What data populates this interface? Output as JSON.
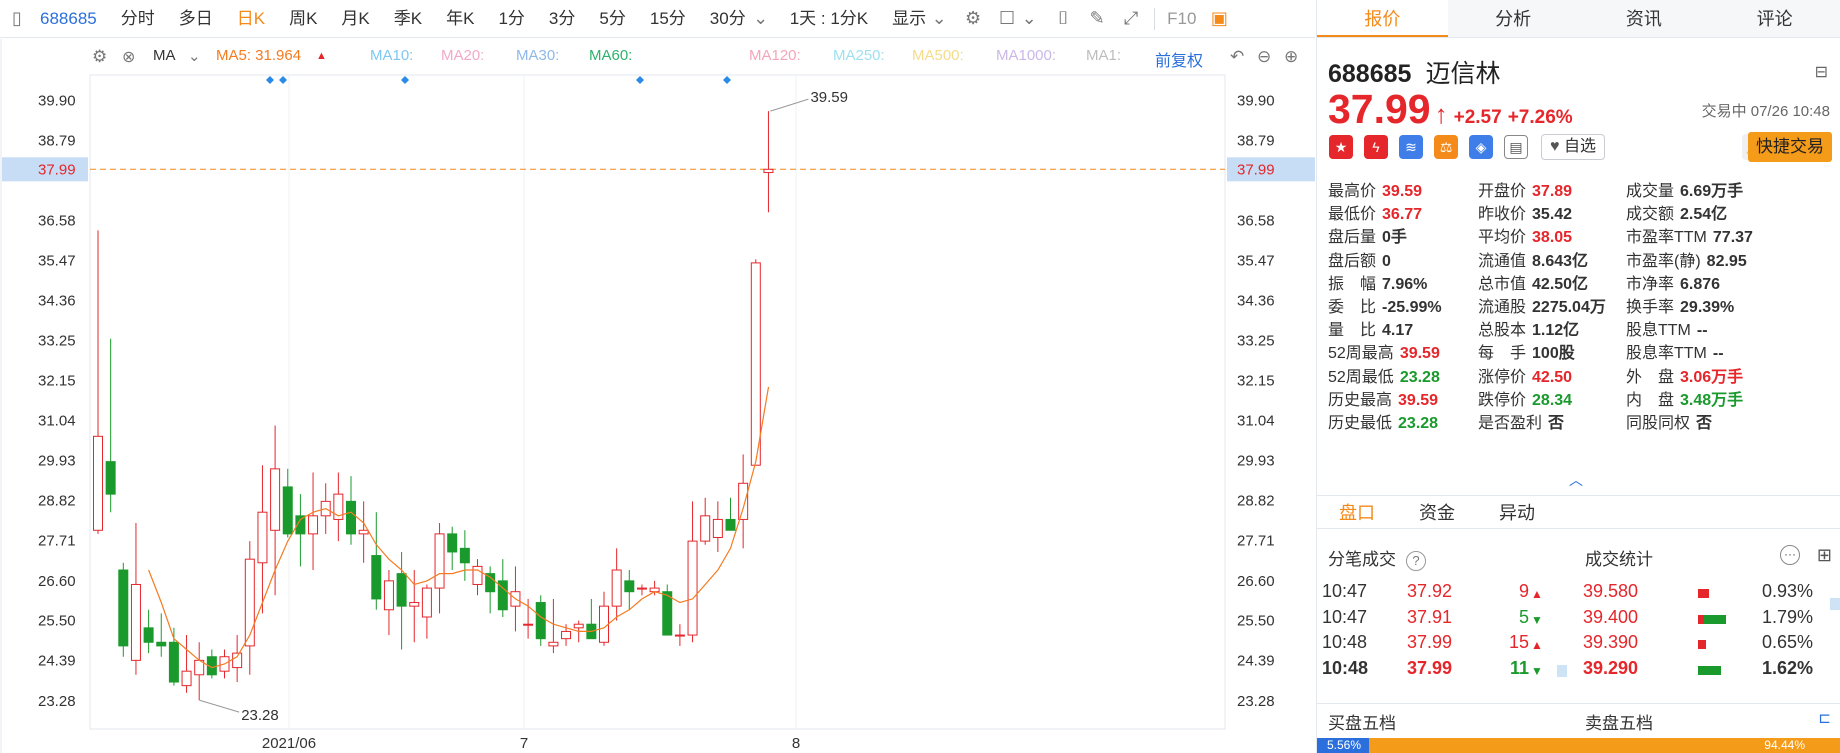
{
  "toolbar": {
    "code": "688685",
    "periods": [
      "分时",
      "多日",
      "日K",
      "周K",
      "月K",
      "季K",
      "年K",
      "1分",
      "3分",
      "5分",
      "15分",
      "30分"
    ],
    "active_period": "日K",
    "range_label": "1天 : 1分K",
    "display_label": "显示",
    "f10_label": "F10"
  },
  "ma_bar": {
    "ma_label": "MA",
    "ma5": "MA5: 31.964",
    "ma10": "MA10:",
    "ma20": "MA20:",
    "ma30": "MA30:",
    "ma60": "MA60:",
    "ma120": "MA120:",
    "ma250": "MA250:",
    "ma500": "MA500:",
    "ma1000": "MA1000:",
    "ma1": "MA1:",
    "fuquan": "前复权",
    "colors": {
      "ma5": "#f47b20",
      "ma10": "#7ec8f2",
      "ma20": "#f4a8c8",
      "ma30": "#8fb8e8",
      "ma60": "#2db36b",
      "ma120": "#f3a6b9",
      "ma250": "#9fe0f0",
      "ma500": "#f5dc8b",
      "ma1000": "#cbb8e8",
      "ma1": "#bdbdbd"
    }
  },
  "chart_data": {
    "type": "candlestick",
    "y_ticks": [
      "39.90",
      "38.79",
      "37.99",
      "36.58",
      "35.47",
      "34.36",
      "33.25",
      "32.15",
      "31.04",
      "29.93",
      "28.82",
      "27.71",
      "26.60",
      "25.50",
      "24.39",
      "23.28"
    ],
    "ylim": [
      22.5,
      40.6
    ],
    "x_ticks": [
      "2021/06",
      "7",
      "8"
    ],
    "current_price": 37.99,
    "high_label": "39.59",
    "low_label": "23.28",
    "up_color": "#e5262b",
    "down_color": "#1a9a2c",
    "ma5_color": "#f47b20",
    "candles": [
      {
        "o": 28.0,
        "h": 36.3,
        "l": 27.9,
        "c": 30.6
      },
      {
        "o": 29.9,
        "h": 33.3,
        "l": 28.5,
        "c": 29.0
      },
      {
        "o": 26.9,
        "h": 27.1,
        "l": 24.5,
        "c": 24.8
      },
      {
        "o": 24.4,
        "h": 28.2,
        "l": 24.0,
        "c": 26.5
      },
      {
        "o": 25.3,
        "h": 25.8,
        "l": 24.6,
        "c": 24.9
      },
      {
        "o": 24.9,
        "h": 25.7,
        "l": 24.5,
        "c": 24.8
      },
      {
        "o": 24.9,
        "h": 25.3,
        "l": 23.7,
        "c": 23.8
      },
      {
        "o": 23.7,
        "h": 25.1,
        "l": 23.5,
        "c": 24.1
      },
      {
        "o": 24.0,
        "h": 24.9,
        "l": 23.3,
        "c": 24.4
      },
      {
        "o": 24.5,
        "h": 24.7,
        "l": 23.9,
        "c": 24.0
      },
      {
        "o": 24.1,
        "h": 24.7,
        "l": 23.9,
        "c": 24.5
      },
      {
        "o": 24.2,
        "h": 25.1,
        "l": 23.8,
        "c": 24.6
      },
      {
        "o": 24.8,
        "h": 27.7,
        "l": 24.0,
        "c": 27.2
      },
      {
        "o": 27.1,
        "h": 29.8,
        "l": 25.7,
        "c": 28.5
      },
      {
        "o": 28.0,
        "h": 30.9,
        "l": 26.2,
        "c": 29.7
      },
      {
        "o": 29.2,
        "h": 29.7,
        "l": 27.8,
        "c": 27.9
      },
      {
        "o": 28.4,
        "h": 29.0,
        "l": 27.0,
        "c": 27.9
      },
      {
        "o": 27.9,
        "h": 29.6,
        "l": 26.9,
        "c": 28.4
      },
      {
        "o": 28.4,
        "h": 29.3,
        "l": 27.9,
        "c": 28.8
      },
      {
        "o": 28.3,
        "h": 29.6,
        "l": 27.7,
        "c": 29.0
      },
      {
        "o": 28.8,
        "h": 29.5,
        "l": 27.6,
        "c": 27.9
      },
      {
        "o": 27.9,
        "h": 28.8,
        "l": 27.1,
        "c": 28.0
      },
      {
        "o": 27.3,
        "h": 28.5,
        "l": 25.8,
        "c": 26.1
      },
      {
        "o": 25.8,
        "h": 26.9,
        "l": 25.1,
        "c": 26.6
      },
      {
        "o": 26.8,
        "h": 27.4,
        "l": 24.7,
        "c": 25.9
      },
      {
        "o": 25.9,
        "h": 26.9,
        "l": 24.9,
        "c": 26.0
      },
      {
        "o": 25.6,
        "h": 26.5,
        "l": 25.0,
        "c": 26.4
      },
      {
        "o": 26.4,
        "h": 28.2,
        "l": 25.7,
        "c": 27.9
      },
      {
        "o": 27.9,
        "h": 28.1,
        "l": 26.9,
        "c": 27.4
      },
      {
        "o": 27.5,
        "h": 28.0,
        "l": 26.6,
        "c": 27.1
      },
      {
        "o": 26.5,
        "h": 27.2,
        "l": 26.2,
        "c": 27.0
      },
      {
        "o": 26.8,
        "h": 27.0,
        "l": 25.7,
        "c": 26.3
      },
      {
        "o": 26.6,
        "h": 27.2,
        "l": 25.6,
        "c": 25.8
      },
      {
        "o": 25.9,
        "h": 27.0,
        "l": 25.2,
        "c": 26.3
      },
      {
        "o": 25.4,
        "h": 26.1,
        "l": 25.0,
        "c": 25.4
      },
      {
        "o": 26.0,
        "h": 26.2,
        "l": 24.8,
        "c": 25.0
      },
      {
        "o": 24.8,
        "h": 26.1,
        "l": 24.6,
        "c": 24.9
      },
      {
        "o": 25.0,
        "h": 25.4,
        "l": 24.8,
        "c": 25.2
      },
      {
        "o": 25.3,
        "h": 25.5,
        "l": 24.9,
        "c": 25.4
      },
      {
        "o": 25.4,
        "h": 26.1,
        "l": 25.0,
        "c": 25.0
      },
      {
        "o": 24.9,
        "h": 26.3,
        "l": 24.8,
        "c": 25.9
      },
      {
        "o": 25.9,
        "h": 27.5,
        "l": 25.5,
        "c": 26.9
      },
      {
        "o": 26.6,
        "h": 26.9,
        "l": 25.8,
        "c": 26.3
      },
      {
        "o": 26.4,
        "h": 26.5,
        "l": 26.2,
        "c": 26.4
      },
      {
        "o": 26.3,
        "h": 26.6,
        "l": 26.2,
        "c": 26.4
      },
      {
        "o": 26.3,
        "h": 26.5,
        "l": 25.1,
        "c": 25.1
      },
      {
        "o": 25.1,
        "h": 25.4,
        "l": 24.8,
        "c": 25.1
      },
      {
        "o": 25.1,
        "h": 28.8,
        "l": 24.9,
        "c": 27.7
      },
      {
        "o": 27.7,
        "h": 28.9,
        "l": 27.6,
        "c": 28.4
      },
      {
        "o": 27.8,
        "h": 28.8,
        "l": 27.4,
        "c": 28.3
      },
      {
        "o": 28.3,
        "h": 28.9,
        "l": 28.0,
        "c": 28.0
      },
      {
        "o": 28.3,
        "h": 30.1,
        "l": 27.5,
        "c": 29.3
      },
      {
        "o": 29.8,
        "h": 35.5,
        "l": 29.8,
        "c": 35.4
      },
      {
        "o": 37.9,
        "h": 39.6,
        "l": 36.8,
        "c": 37.99
      }
    ],
    "ma5": [
      null,
      null,
      null,
      null,
      26.9,
      26.0,
      25.0,
      24.7,
      24.4,
      24.2,
      24.3,
      24.5,
      25.1,
      26.0,
      26.9,
      27.7,
      28.3,
      28.5,
      28.6,
      28.4,
      28.5,
      28.2,
      27.6,
      27.2,
      26.9,
      26.5,
      26.6,
      26.8,
      26.8,
      26.9,
      26.9,
      26.7,
      26.4,
      26.1,
      25.9,
      25.6,
      25.4,
      25.3,
      25.2,
      25.2,
      25.3,
      25.6,
      25.8,
      26.1,
      26.3,
      26.2,
      26.0,
      26.1,
      26.5,
      26.9,
      27.5,
      28.6,
      29.9,
      31.964
    ]
  },
  "quote": {
    "tabs": [
      "报价",
      "分析",
      "资讯",
      "评论"
    ],
    "active_tab": "报价",
    "code": "688685",
    "name": "迈信林",
    "price": "37.99",
    "change": "+2.57",
    "change_pct": "+7.26%",
    "trade_status": "交易中 07/26 10:48",
    "zixuan_label": "自选",
    "fast_trade_label": "快捷交易",
    "stats": [
      {
        "k": "最高价",
        "v": "39.59",
        "c": "red"
      },
      {
        "k": "开盘价",
        "v": "37.89",
        "c": "red"
      },
      {
        "k": "成交量",
        "v": "6.69万手",
        "c": "gray"
      },
      {
        "k": "最低价",
        "v": "36.77",
        "c": "red"
      },
      {
        "k": "昨收价",
        "v": "35.42",
        "c": "gray"
      },
      {
        "k": "成交额",
        "v": "2.54亿",
        "c": "gray"
      },
      {
        "k": "盘后量",
        "v": "0手",
        "c": "gray"
      },
      {
        "k": "平均价",
        "v": "38.05",
        "c": "red"
      },
      {
        "k": "市盈率TTM",
        "v": "77.37",
        "c": "gray"
      },
      {
        "k": "盘后额",
        "v": "0",
        "c": "gray"
      },
      {
        "k": "流通值",
        "v": "8.643亿",
        "c": "gray"
      },
      {
        "k": "市盈率(静)",
        "v": "82.95",
        "c": "gray"
      },
      {
        "k": "振　幅",
        "v": "7.96%",
        "c": "gray"
      },
      {
        "k": "总市值",
        "v": "42.50亿",
        "c": "gray"
      },
      {
        "k": "市净率",
        "v": "6.876",
        "c": "gray"
      },
      {
        "k": "委　比",
        "v": "-25.99%",
        "c": "gray"
      },
      {
        "k": "流通股",
        "v": "2275.04万",
        "c": "gray"
      },
      {
        "k": "换手率",
        "v": "29.39%",
        "c": "gray"
      },
      {
        "k": "量　比",
        "v": "4.17",
        "c": "gray"
      },
      {
        "k": "总股本",
        "v": "1.12亿",
        "c": "gray"
      },
      {
        "k": "股息TTM",
        "v": "--",
        "c": "gray"
      },
      {
        "k": "52周最高",
        "v": "39.59",
        "c": "red"
      },
      {
        "k": "每　手",
        "v": "100股",
        "c": "gray"
      },
      {
        "k": "股息率TTM",
        "v": "--",
        "c": "gray"
      },
      {
        "k": "52周最低",
        "v": "23.28",
        "c": "green"
      },
      {
        "k": "涨停价",
        "v": "42.50",
        "c": "red"
      },
      {
        "k": "外　盘",
        "v": "3.06万手",
        "c": "red"
      },
      {
        "k": "历史最高",
        "v": "39.59",
        "c": "red"
      },
      {
        "k": "跌停价",
        "v": "28.34",
        "c": "green"
      },
      {
        "k": "内　盘",
        "v": "3.48万手",
        "c": "green"
      },
      {
        "k": "历史最低",
        "v": "23.28",
        "c": "green"
      },
      {
        "k": "是否盈利",
        "v": "否",
        "c": "gray"
      },
      {
        "k": "同股同权",
        "v": "否",
        "c": "gray"
      }
    ],
    "sub_tabs": [
      "盘口",
      "资金",
      "异动"
    ],
    "active_sub_tab": "盘口",
    "fenbi_title": "分笔成交",
    "tjs_title": "成交统计",
    "ticks": [
      {
        "t": "10:47",
        "p": "37.92",
        "v": "9",
        "dir": "up",
        "sp": "39.580",
        "pct": "0.93%",
        "red": 0.35,
        "green": 0.0
      },
      {
        "t": "10:47",
        "p": "37.91",
        "v": "5",
        "dir": "down",
        "sp": "39.400",
        "pct": "1.79%",
        "red": 0.2,
        "green": 0.7
      },
      {
        "t": "10:48",
        "p": "37.99",
        "v": "15",
        "dir": "up",
        "sp": "39.390",
        "pct": "0.65%",
        "red": 0.25,
        "green": 0.0
      },
      {
        "t": "10:48",
        "p": "37.99",
        "v": "11",
        "dir": "down",
        "sp": "39.290",
        "pct": "1.62%",
        "red": 0.0,
        "green": 0.72
      }
    ],
    "buy5_label": "买盘五档",
    "sell5_label": "卖盘五档",
    "bottom_left": "5.56%",
    "bottom_right": "94.44%"
  }
}
